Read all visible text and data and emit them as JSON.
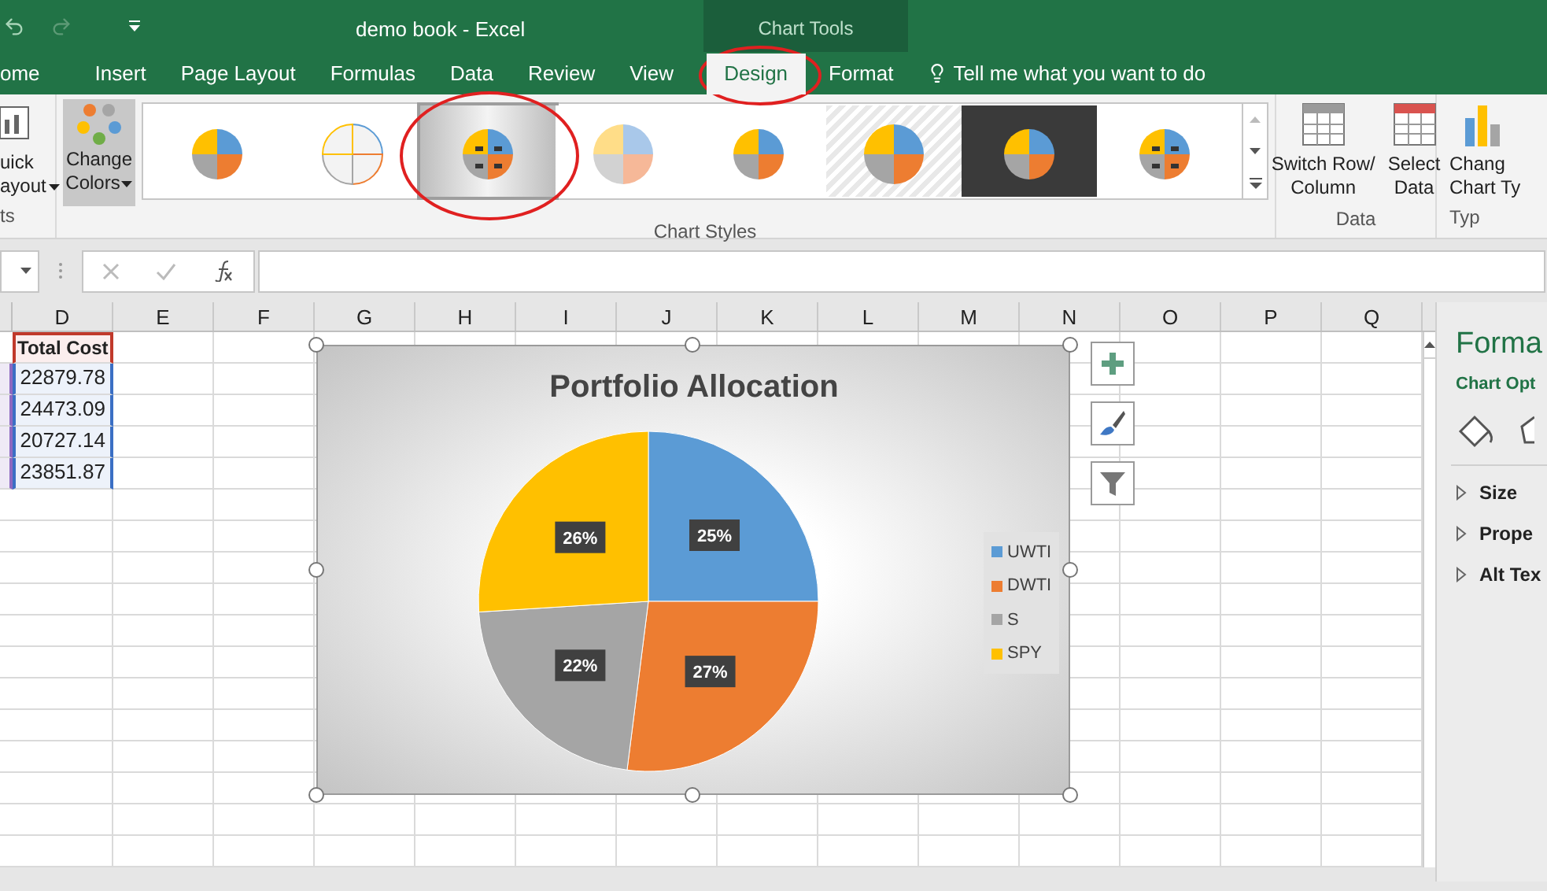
{
  "window": {
    "title": "demo book - Excel",
    "context_tab_group": "Chart Tools"
  },
  "ribbon_tabs": [
    {
      "label": "ome",
      "selected": false
    },
    {
      "label": "Insert",
      "selected": false
    },
    {
      "label": "Page Layout",
      "selected": false
    },
    {
      "label": "Formulas",
      "selected": false
    },
    {
      "label": "Data",
      "selected": false
    },
    {
      "label": "Review",
      "selected": false
    },
    {
      "label": "View",
      "selected": false
    },
    {
      "label": "Design",
      "selected": true
    },
    {
      "label": "Format",
      "selected": false
    }
  ],
  "tell_me": {
    "placeholder": "Tell me what you want to do"
  },
  "ribbon": {
    "quick_layout": {
      "line1": "uick",
      "line2": "ayout",
      "group": "ts"
    },
    "change_colors": {
      "line1": "Change",
      "line2": "Colors"
    },
    "chart_styles": {
      "group": "Chart Styles",
      "thumbnails": [
        {
          "kind": "plain",
          "selected": false
        },
        {
          "kind": "hatched",
          "selected": false
        },
        {
          "kind": "gradient",
          "selected": true
        },
        {
          "kind": "pastel",
          "selected": false
        },
        {
          "kind": "plain",
          "selected": false
        },
        {
          "kind": "striped",
          "selected": false
        },
        {
          "kind": "dark",
          "selected": false
        },
        {
          "kind": "labeled",
          "selected": false
        }
      ]
    },
    "data_group": {
      "group": "Data",
      "buttons": [
        {
          "line1": "Switch Row/",
          "line2": "Column"
        },
        {
          "line1": "Select",
          "line2": "Data"
        }
      ]
    },
    "type_group": {
      "group": "Typ",
      "line1": "Chang",
      "line2": "Chart Ty"
    }
  },
  "columns": [
    "D",
    "E",
    "F",
    "G",
    "H",
    "I",
    "J",
    "K",
    "L",
    "M",
    "N",
    "O",
    "P",
    "Q"
  ],
  "cells": [
    {
      "kind": "header",
      "value": "Total Cost"
    },
    {
      "kind": "value",
      "value": "22879.78"
    },
    {
      "kind": "value",
      "value": "24473.09"
    },
    {
      "kind": "value",
      "value": "20727.14"
    },
    {
      "kind": "value",
      "value": "23851.87"
    }
  ],
  "chart": {
    "chart_data": {
      "type": "pie",
      "title": "Portfolio Allocation",
      "categories": [
        "UWTI",
        "DWTI",
        "S",
        "SPY"
      ],
      "values": [
        25,
        27,
        22,
        26
      ],
      "colors": [
        "#5b9bd5",
        "#ed7d31",
        "#a5a5a5",
        "#ffc000"
      ],
      "data_labels": "value_labels",
      "value_labels": [
        "25%",
        "27%",
        "22%",
        "26%"
      ]
    }
  },
  "format_pane": {
    "title": "Forma",
    "subtitle": "Chart Opt",
    "sections": [
      {
        "label": "Size",
        "expanded": false
      },
      {
        "label": "Prope",
        "expanded": false
      },
      {
        "label": "Alt Tex",
        "expanded": false
      }
    ]
  }
}
